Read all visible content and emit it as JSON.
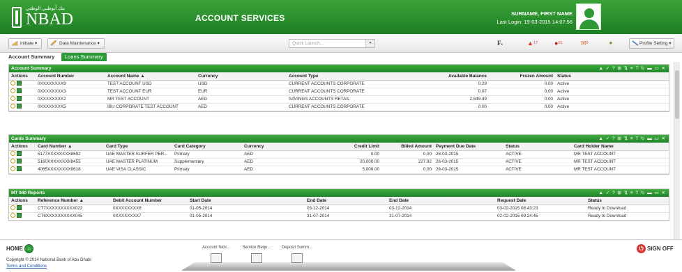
{
  "header": {
    "logo_arabic": "بنك أبوظبي الوطني",
    "logo_text": "NBAD",
    "title": "ACCOUNT SERVICES",
    "user_name": "SURNAME, FIRST NAME",
    "last_login": "Last Login: 19-03-2015 14:07:56"
  },
  "toolbar": {
    "initiate": "Initiate",
    "data_maintenance": "Data Maintenance",
    "quick_launch_placeholder": "Quick Launch...",
    "fx_icon_label": "F",
    "alerts_count": "17",
    "messages_count": "01",
    "mail_count": "0",
    "profile_setting": "Profile Setting"
  },
  "tabs": {
    "active": "Account Summary",
    "inactive": "Loans Summary"
  },
  "table_tools": "▲ ✓ ? ⊞ ⇅ ≡ T ↻ ▬ ▭ ✕",
  "account_summary": {
    "title": "Account Summary",
    "columns": [
      "Actions",
      "Account Number",
      "Account Name ▲",
      "Currency",
      "Account Type",
      "Available Balance",
      "Frozen Amount",
      "Status"
    ],
    "rows": [
      [
        "0XXXXXXXX9",
        "TEST ACCOUNT USD",
        "USD",
        "CURRENT ACCOUNTS CORPORATE",
        "0.29",
        "0.00",
        "Active"
      ],
      [
        "0XXXXXXXX3",
        "TEST ACCOUNT EUR",
        "EUR",
        "CURRENT ACCOUNTS CORPORATE",
        "0.07",
        "0.00",
        "Active"
      ],
      [
        "0XXXXXXXX2",
        "MR  TEST ACCOUNT",
        "AED",
        "SAVINGS ACCOUNTS RETAIL",
        "2,649.49",
        "0.00",
        "Active"
      ],
      [
        "0XXXXXXXX5",
        "IBU CORPORATE TEST ACCOUNT",
        "AED",
        "CURRENT ACCOUNTS CORPORATE",
        "0.00",
        "0.00",
        "Active"
      ]
    ]
  },
  "cards_summary": {
    "title": "Cards Summary",
    "columns": [
      "Actions",
      "Card Number ▲",
      "Card Type",
      "Card Category",
      "Currency",
      "Credit Limit",
      "Billed Amount",
      "Payment Due Date",
      "Status",
      "Card Holder Name"
    ],
    "rows": [
      [
        "5177XXXXXXXX8692",
        "UAE MASTER SURFER PER...",
        "Primary",
        "AED",
        "0.00",
        "0.00",
        "26-03-2015",
        "ACTIVE",
        "MR  TEST ACCOUNT"
      ],
      [
        "5160XXXXXXXX8455",
        "UAE MASTER PLATINUM",
        "Supplementary",
        "AED",
        "20,000.00",
        "227.92",
        "26-03-2015",
        "ACTIVE",
        "MR  TEST ACCOUNT"
      ],
      [
        "4065XXXXXXXX8618",
        "UAE VISA CLASSIC",
        "Primary",
        "AED",
        "5,000.00",
        "0.00",
        "26-03-2015",
        "ACTIVE",
        "MR  TEST ACCOUNT"
      ]
    ]
  },
  "mt940_reports": {
    "title": "MT 940 Reports",
    "columns": [
      "Actions",
      "Reference Number ▲",
      "Debit Account Number",
      "Start Date",
      "End Date",
      "End Date",
      "Request Date",
      "Status"
    ],
    "rows": [
      [
        "CT7XXXXXXXXXX022",
        "0XXXXXXXX8",
        "01-05-2014",
        "03-12-2014",
        "03-12-2014",
        "03-02-2015 08:43:23",
        "Ready to Download"
      ],
      [
        "CT6XXXXXXXXXX045",
        "0XXXXXXXX7",
        "01-05-2014",
        "31-07-2014",
        "31-07-2014",
        "02-02-2015 09:24:45",
        "Ready to Download"
      ]
    ]
  },
  "footer": {
    "home": "HOME",
    "copyright": "Copyright © 2014 National Bank of Abu Dhabi",
    "terms": "Terms and Conditions",
    "dock": [
      "Account Nick...",
      "Service Requ...",
      "Deposit Summ..."
    ],
    "sign_off": "SIGN OFF"
  },
  "colors": {
    "brand_green": "#2e9b3a",
    "header_green": "#1e7f24"
  }
}
